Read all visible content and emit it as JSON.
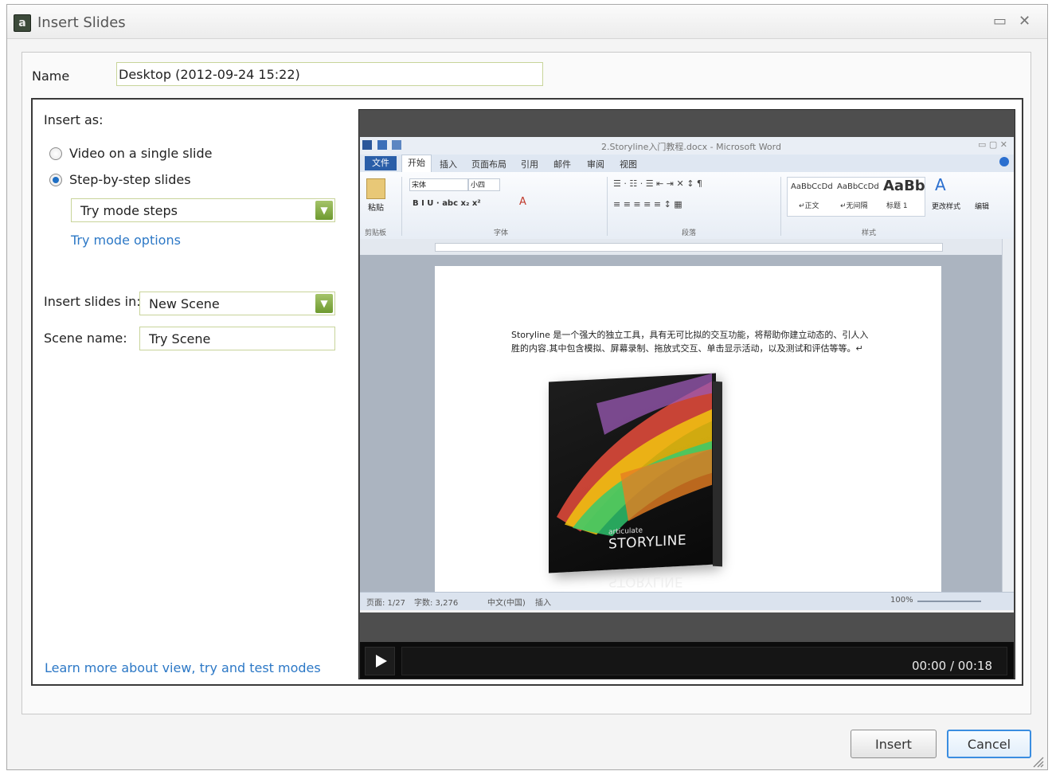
{
  "window": {
    "title": "Insert Slides",
    "app_icon_glyph": "a",
    "minimize_icon": "▭",
    "close_icon": "✕"
  },
  "name_field": {
    "label": "Name",
    "value": "Desktop (2012-09-24 15:22)"
  },
  "insert_as": {
    "heading": "Insert as:",
    "options": [
      {
        "label": "Video on a single slide",
        "selected": false
      },
      {
        "label": "Step-by-step slides",
        "selected": true
      }
    ],
    "mode_select": {
      "value": "Try mode steps"
    },
    "mode_options_link": "Try mode options"
  },
  "insert_in": {
    "label": "Insert slides in:",
    "value": "New Scene"
  },
  "scene_name": {
    "label": "Scene name:",
    "value": "Try Scene"
  },
  "learn_more_link": "Learn more about view, try and test modes",
  "preview": {
    "word_title": "2.Storyline入门教程.docx - Microsoft Word",
    "tabs": [
      "文件",
      "开始",
      "插入",
      "页面布局",
      "引用",
      "邮件",
      "审阅",
      "视图"
    ],
    "ribbon": {
      "paste": "粘贴",
      "font_name": "宋体",
      "font_size": "小四",
      "groups": [
        "剪贴板",
        "字体",
        "段落",
        "样式"
      ],
      "styles": [
        "AaBbCcDd",
        "AaBbCcDd",
        "AaBb"
      ],
      "style_names": [
        "↵正文",
        "↵无间隔",
        "标题 1"
      ],
      "change_styles": "更改样式",
      "edit": "编辑"
    },
    "document_text": "Storyline 是一个强大的独立工具，具有无可比拟的交互功能，将帮助你建立动态的、引人入胜的内容.其中包含模拟、屏幕录制、拖放式交互、单击显示活动，以及测试和评估等等。↵",
    "box_brand_small": "articulate",
    "box_brand": "STORYLINE",
    "status": {
      "page": "页面: 1/27",
      "words": "字数: 3,276",
      "language": "中文(中国)",
      "mode": "插入",
      "zoom": "100%"
    },
    "player": {
      "timecode": "00:00 / 00:18"
    }
  },
  "buttons": {
    "insert": "Insert",
    "cancel": "Cancel"
  }
}
